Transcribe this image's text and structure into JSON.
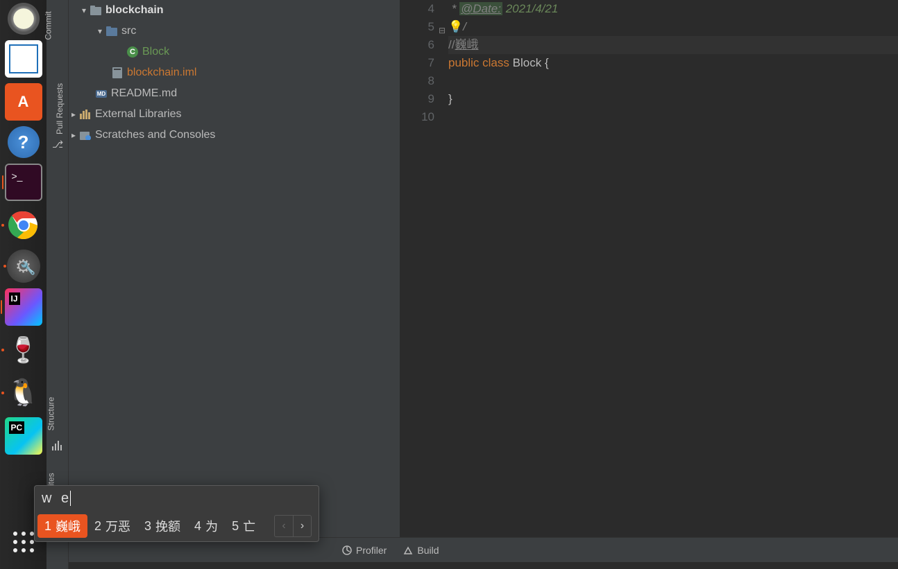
{
  "launcher": {
    "icons": [
      "disk",
      "libreoffice",
      "software",
      "help",
      "terminal",
      "chrome",
      "settings",
      "intellij",
      "wine",
      "qq",
      "pycharm"
    ]
  },
  "ide_strip": {
    "labels": {
      "commit": "Commit",
      "pull_requests": "Pull Requests",
      "structure": "Structure",
      "favorites": "Favorites"
    }
  },
  "tree": {
    "project": "blockchain",
    "src": "src",
    "block": "Block",
    "iml": "blockchain.iml",
    "readme": "README.md",
    "external": "External Libraries",
    "scratches": "Scratches and Consoles"
  },
  "editor": {
    "lines": [
      "4",
      "5",
      "6",
      "7",
      "8",
      "9",
      "10"
    ],
    "date_tag": "@Date:",
    "date_val": "2021/4/21",
    "comment_prefix": "//",
    "comment_text": "巍峨",
    "kw_public": "public",
    "kw_class": "class",
    "class_name": "Block",
    "brace_open": "{",
    "brace_close": "}"
  },
  "bottom": {
    "profiler": "Profiler",
    "build": "Build"
  },
  "ime": {
    "input": "w e",
    "candidates": [
      {
        "n": "1",
        "t": "巍峨"
      },
      {
        "n": "2",
        "t": "万恶"
      },
      {
        "n": "3",
        "t": "挽额"
      },
      {
        "n": "4",
        "t": "为"
      },
      {
        "n": "5",
        "t": "亡"
      }
    ]
  }
}
